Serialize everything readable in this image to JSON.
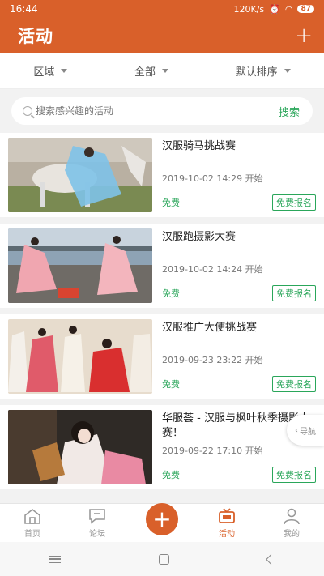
{
  "status_bar": {
    "time": "16:44",
    "network": "120K/s",
    "battery": "87"
  },
  "header": {
    "title": "活动",
    "add_label": "+"
  },
  "filters": [
    {
      "label": "区域"
    },
    {
      "label": "全部"
    },
    {
      "label": "默认排序"
    }
  ],
  "search": {
    "placeholder": "搜索感兴趣的活动",
    "button_label": "搜索"
  },
  "activities": [
    {
      "title": "汉服骑马挑战赛",
      "time": "2019-10-02 14:29 开始",
      "price": "免费",
      "action": "免费报名"
    },
    {
      "title": "汉服跑摄影大赛",
      "time": "2019-10-02 14:24 开始",
      "price": "免费",
      "action": "免费报名"
    },
    {
      "title": "汉服推广大使挑战赛",
      "time": "2019-09-23 23:22 开始",
      "price": "免费",
      "action": "免费报名"
    },
    {
      "title": "华服荟 - 汉服与枫叶秋季摄影大赛！",
      "time": "2019-09-22 17:10 开始",
      "price": "免费",
      "action": "免费报名"
    }
  ],
  "float_nav": {
    "label": "导航"
  },
  "tabbar": [
    {
      "label": "首页"
    },
    {
      "label": "论坛"
    },
    {
      "label": "+"
    },
    {
      "label": "活动"
    },
    {
      "label": "我的"
    }
  ],
  "colors": {
    "brand": "#d9602a",
    "accent_green": "#2aa65a"
  }
}
